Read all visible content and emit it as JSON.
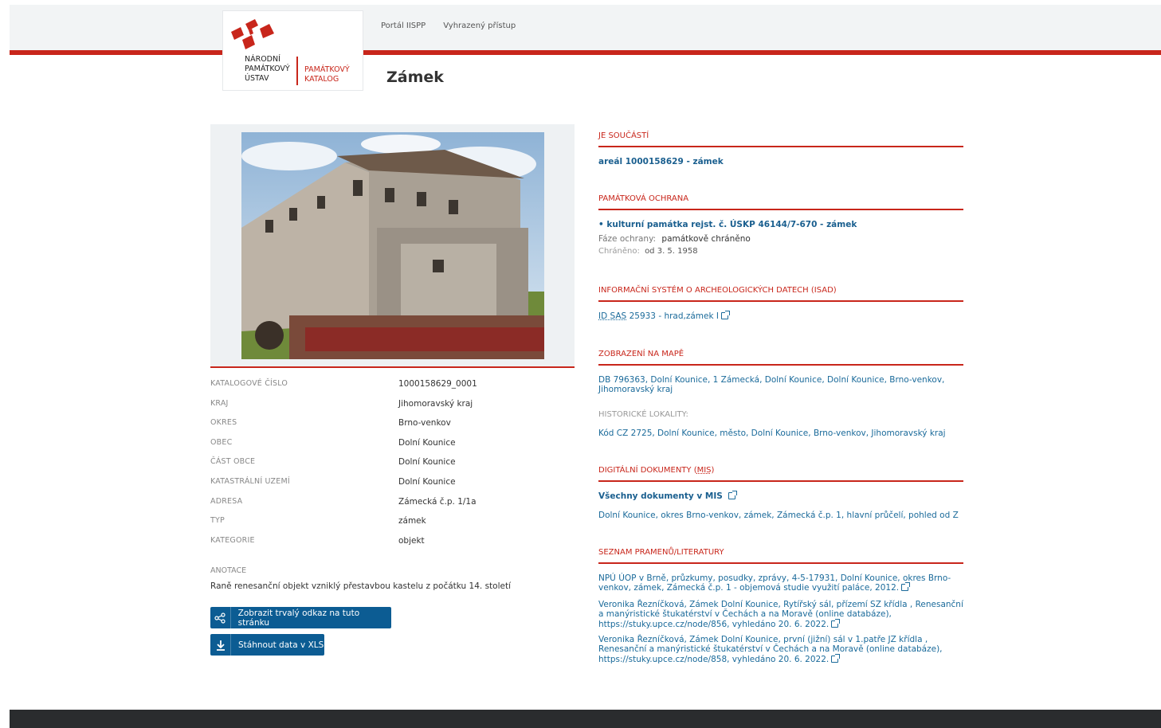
{
  "logo": {
    "org_lines": [
      "NÁRODNÍ",
      "PAMÁTKOVÝ",
      "ÚSTAV"
    ],
    "product_lines": [
      "PAMÁTKOVÝ",
      "KATALOG"
    ],
    "brand_color": "#c8261b"
  },
  "nav": {
    "items": [
      {
        "label": "Portál IISPP"
      },
      {
        "label": "Vyhrazený přístup"
      }
    ]
  },
  "page": {
    "title": "Zámek"
  },
  "details": {
    "rows": [
      {
        "key": "KATALOGOVÉ ČÍSLO",
        "value": "1000158629_0001"
      },
      {
        "key": "KRAJ",
        "value": "Jihomoravský kraj"
      },
      {
        "key": "OKRES",
        "value": "Brno-venkov"
      },
      {
        "key": "OBEC",
        "value": "Dolní Kounice"
      },
      {
        "key": "ČÁST OBCE",
        "value": "Dolní Kounice"
      },
      {
        "key": "KATASTRÁLNÍ UZEMÍ",
        "value": "Dolní Kounice"
      },
      {
        "key": "ADRESA",
        "value": "Zámecká č.p. 1/1a"
      },
      {
        "key": "TYP",
        "value": "zámek"
      },
      {
        "key": "KATEGORIE",
        "value": "objekt"
      }
    ],
    "anotace_label": "ANOTACE",
    "anotace_text": "Raně renesanční objekt vzniklý přestavbou kastelu z počátku 14. století"
  },
  "buttons": {
    "permalink": "Zobrazit trvalý odkaz na tuto stránku",
    "download": "Stáhnout data v XLS"
  },
  "sections": {
    "part_of": {
      "title": "JE SOUČÁSTÍ",
      "link": "areál 1000158629 - zámek"
    },
    "protection": {
      "title": "PAMÁTKOVÁ OCHRANA",
      "link": "• kulturní památka rejst. č. ÚSKP 46144/7-670 - zámek",
      "phase_label": "Fáze ochrany:",
      "phase_value": "památkově chráněno",
      "protected_label": "Chráněno:",
      "protected_value": "od 3. 5. 1958"
    },
    "isad": {
      "title": "INFORMAČNÍ SYSTÉM O ARCHEOLOGICKÝCH DATECH (ISAD)",
      "id_label": "ID SAS",
      "link": "25933 - hrad,zámek I"
    },
    "map": {
      "title": "ZOBRAZENÍ NA MAPĚ",
      "link": "DB 796363, Dolní Kounice, 1 Zámecká, Dolní Kounice, Dolní Kounice, Brno-venkov, Jihomoravský kraj",
      "hist_label": "HISTORICKÉ LOKALITY:",
      "hist_link": "Kód CZ 2725, Dolní Kounice, město, Dolní Kounice, Brno-venkov, Jihomoravský kraj"
    },
    "docs": {
      "title_prefix": "DIGITÁLNÍ DOKUMENTY (",
      "title_abbr": "MIS",
      "title_suffix": ")",
      "all_link": "Všechny dokumenty v MIS",
      "doc_link": "Dolní Kounice, okres Brno-venkov, zámek, Zámecká č.p. 1, hlavní průčelí, pohled od Z"
    },
    "sources": {
      "title": "SEZNAM PRAMENŮ/LITERATURY",
      "items": [
        "NPÚ ÚOP v Brně, průzkumy, posudky, zprávy, 4-5-17931, Dolní Kounice, okres Brno-venkov, zámek, Zámecká č.p. 1 - objemová studie využití paláce, 2012.",
        "Veronika Řezníčková, Zámek Dolní Kounice, Rytířský sál, přízemí SZ křídla , Renesanční a manýristické štukatérství v Čechách a na Moravě (online databáze), https://stuky.upce.cz/node/856, vyhledáno 20. 6. 2022.",
        "Veronika Řezníčková, Zámek Dolní Kounice, první (jižní) sál v 1.patře JZ křídla , Renesanční a manýristické štukatérství v Čechách a na Moravě (online databáze), https://stuky.upce.cz/node/858, vyhledáno 20. 6. 2022."
      ]
    }
  }
}
